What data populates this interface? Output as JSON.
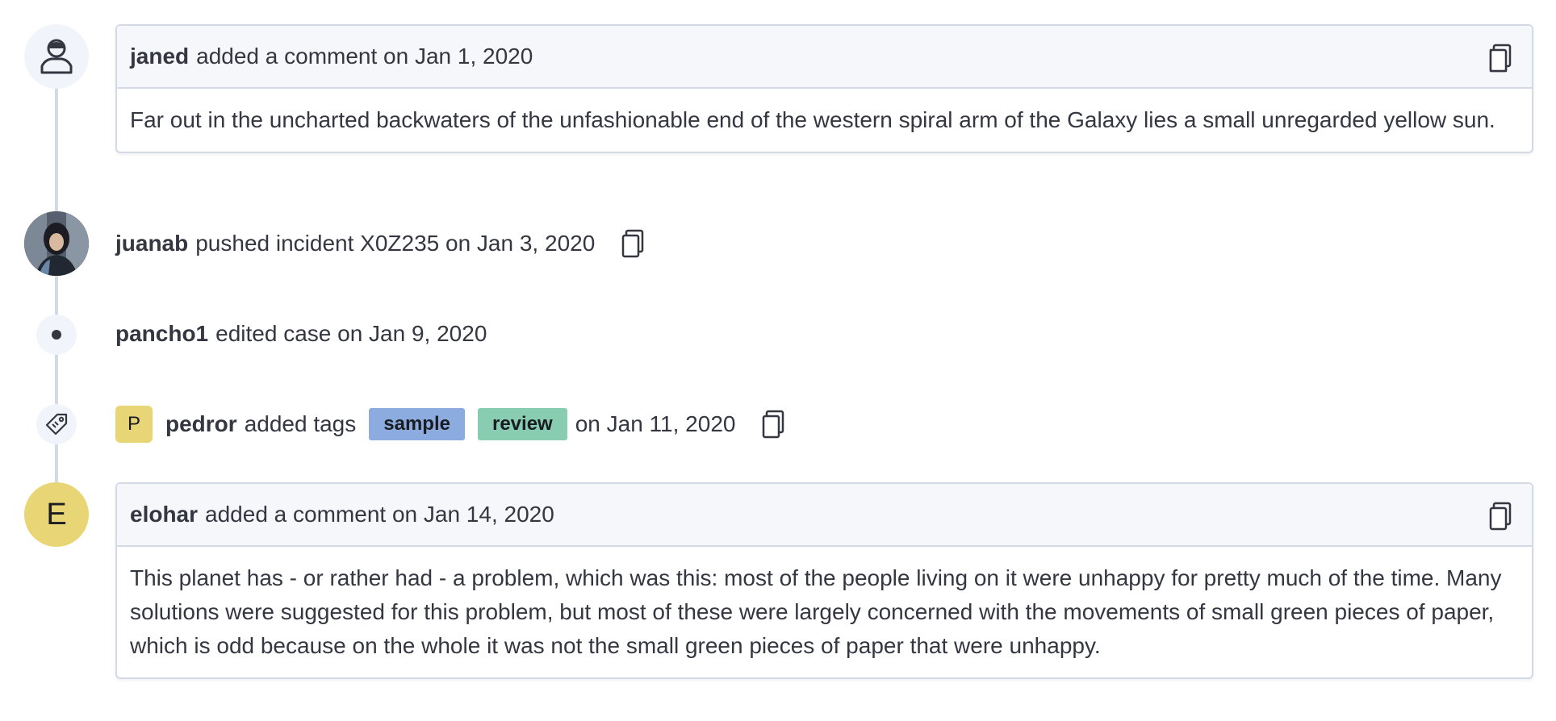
{
  "colors": {
    "timeline_line": "#d3dae6",
    "header_bg": "#f5f7fa",
    "accent_yellow": "#e7d576",
    "tag_sample": "#8cace0",
    "tag_review": "#88cdb1"
  },
  "events": {
    "comment1": {
      "avatar_icon": "user-icon",
      "user": "janed",
      "action": "added a comment on Jan 1, 2020",
      "body": "Far out in the uncharted backwaters of the unfashionable end of the western spiral arm of the Galaxy lies a small unregarded yellow sun."
    },
    "push": {
      "avatar_icon": "user-photo",
      "user": "juanab",
      "action": "pushed incident X0Z235 on Jan 3, 2020"
    },
    "edit": {
      "avatar_icon": "dot-icon",
      "user": "pancho1",
      "action": "edited case on Jan 9, 2020"
    },
    "tags": {
      "avatar_icon": "tag-icon",
      "initial": "P",
      "user": "pedror",
      "action": "added tags",
      "tag_list": [
        "sample",
        "review"
      ],
      "date_text": "on Jan 11, 2020"
    },
    "comment2": {
      "avatar_letter": "E",
      "user": "elohar",
      "action": "added a comment on Jan 14, 2020",
      "body": "This planet has - or rather had - a problem, which was this: most of the people living on it were unhappy for pretty much of the time. Many solutions were suggested for this problem, but most of these were largely concerned with the movements of small green pieces of paper, which is odd because on the whole it was not the small green pieces of paper that were unhappy."
    }
  }
}
